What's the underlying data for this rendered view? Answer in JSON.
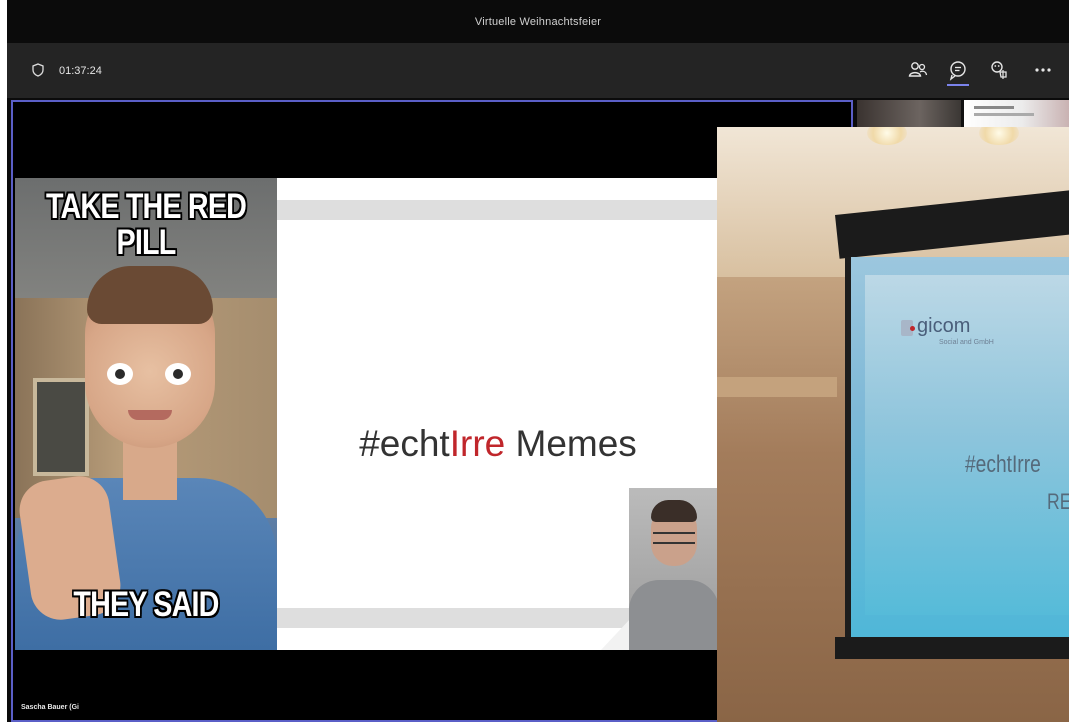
{
  "window": {
    "title": "Virtuelle Weihnachtsfeier"
  },
  "toolbar": {
    "timer": "01:37:24",
    "icons": [
      "shield-icon",
      "participants-icon",
      "chat-icon",
      "reactions-icon",
      "more-icon"
    ],
    "accent_color": "#7b83eb"
  },
  "stage": {
    "border_color": "#5b5fc7",
    "participant_name": "Sascha Bauer (Gi"
  },
  "slide": {
    "meme_top_line1": "TAKE THE RED",
    "meme_top_line2": "PILL",
    "meme_bottom": "THEY SAID",
    "title_prefix": "#echt",
    "title_red": "Irre",
    "title_suffix": " Memes",
    "red_color": "#c0262b",
    "yellow_color": "#ffbf00"
  },
  "overlay_photo": {
    "logo_text": "gicom",
    "logo_subtitle": "Social and GmbH",
    "projected_line1": "#echtIrre",
    "projected_line2": "RE"
  }
}
